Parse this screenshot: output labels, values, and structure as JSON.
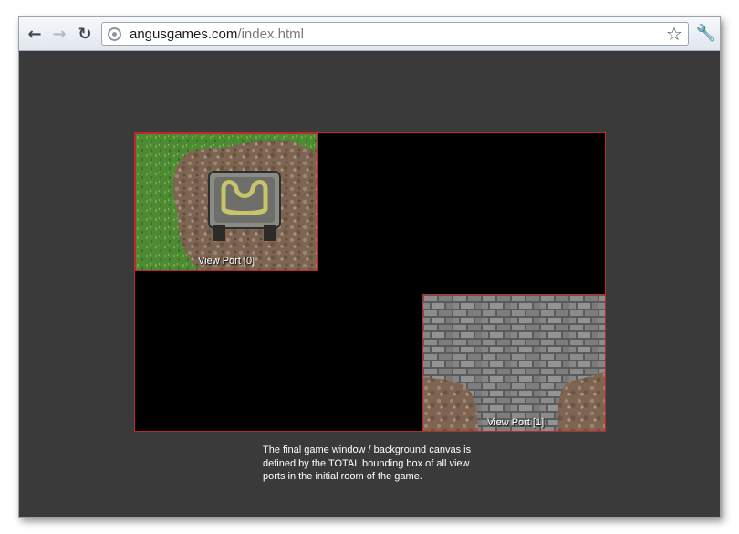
{
  "browser": {
    "url_host": "angusgames.com",
    "url_path": "/index.html",
    "icons": [
      "back-arrow-icon",
      "forward-arrow-icon",
      "reload-icon",
      "globe-icon",
      "star-icon",
      "wrench-icon"
    ]
  },
  "game": {
    "viewports": [
      {
        "label": "View Port [0]"
      },
      {
        "label": "View Port [1]"
      }
    ],
    "caption": "The final game window / background canvas is defined by the TOTAL bounding box of all view ports in the initial room of the game."
  },
  "colors": {
    "page_background": "#3a3a3a",
    "canvas": "#000000",
    "viewport_border": "#c0262b"
  }
}
